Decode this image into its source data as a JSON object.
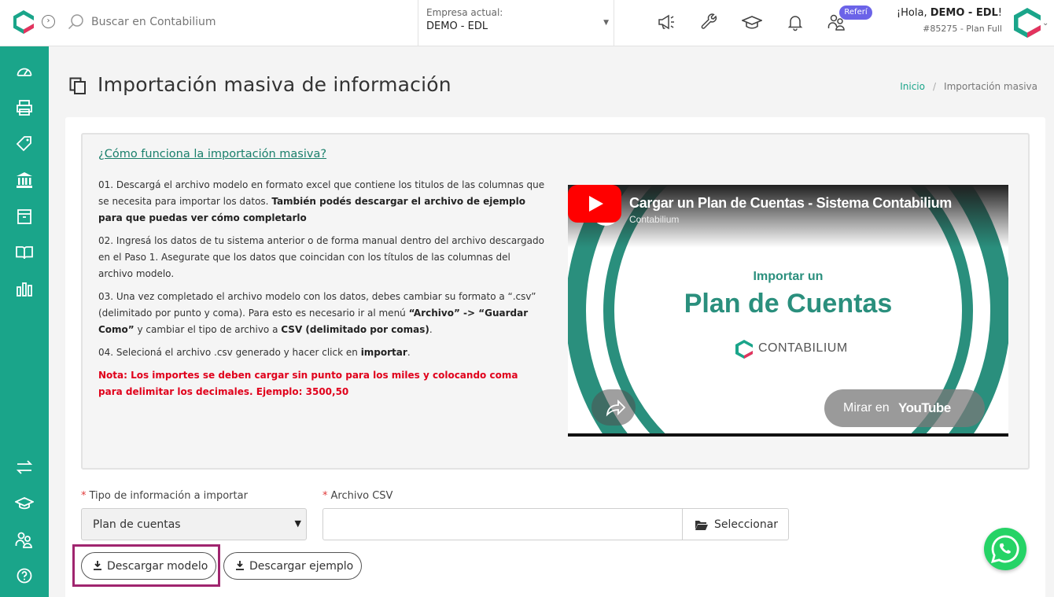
{
  "topbar": {
    "search_placeholder": "Buscar en Contabilium",
    "company_label": "Empresa actual:",
    "company_value": "DEMO - EDL",
    "referral_badge": "Referí",
    "greeting_prefix": "¡Hola, ",
    "user_name": "DEMO - EDL",
    "greeting_suffix": "!",
    "plan_info": "#85275 - Plan Full",
    "icons": [
      "megaphone-icon",
      "wrench-icon",
      "graduation-cap-icon",
      "bell-icon",
      "users-icon"
    ]
  },
  "sidebar": {
    "icons": [
      "dashboard-icon",
      "printer-icon",
      "tag-icon",
      "bank-icon",
      "archive-icon",
      "book-icon",
      "bar-chart-icon",
      "transfer-icon",
      "graduation-cap-icon",
      "users-icon",
      "help-icon"
    ]
  },
  "page": {
    "title": "Importación masiva de información",
    "breadcrumb_home": "Inicio",
    "breadcrumb_sep": "/",
    "breadcrumb_current": "Importación masiva"
  },
  "instructions": {
    "heading": "¿Cómo funciona la importación masiva?",
    "step1_text": "01. Descargá el archivo modelo en formato excel que contiene los titulos de las columnas que se necesita para importar los datos. ",
    "step1_bold": "También podés descargar el archivo de ejemplo para que puedas ver cómo completarlo",
    "step2_text": "02. Ingresá los datos de tu sistema anterior o de forma manual dentro del archivo descargado en el Paso 1. Asegurate que los datos que coincidan con los títulos de las columnas del archivo modelo.",
    "step3_a": "03. Una vez completado el archivo modelo con los datos, debes cambiar su formato a “.csv” (delimitado por punto y coma). Para esto es necesario ir al menú ",
    "step3_b": "“Archivo” -> “Guardar Como”",
    "step3_c": " y cambiar el tipo de archivo a ",
    "step3_d": "CSV (delimitado por comas)",
    "step3_e": ".",
    "step4_a": "04. Selecioná el archivo .csv generado y hacer click en ",
    "step4_b": "importar",
    "step4_c": ".",
    "note": "Nota: Los importes se deben cargar sin punto para los miles y colocando coma para delimitar los decimales. Ejemplo: 3500,50"
  },
  "video": {
    "title": "Cargar un Plan de Cuentas - Sistema Contabilium",
    "channel": "Contabilium",
    "slide_line1": "Importar un",
    "slide_line2": "Plan de Cuentas",
    "slide_brand": "CONTABILIUM",
    "watch_label": "Mirar en",
    "watch_brand": "YouTube"
  },
  "form": {
    "type_label": "Tipo de información a importar",
    "type_value": "Plan de cuentas",
    "file_label": "Archivo CSV",
    "select_button": "Seleccionar",
    "download_model": "Descargar modelo",
    "download_example": "Descargar ejemplo"
  },
  "colors": {
    "brand_teal": "#1aa58a",
    "brand_pink": "#e4335e",
    "highlight": "#a0256f",
    "note_red": "#e0001b"
  }
}
